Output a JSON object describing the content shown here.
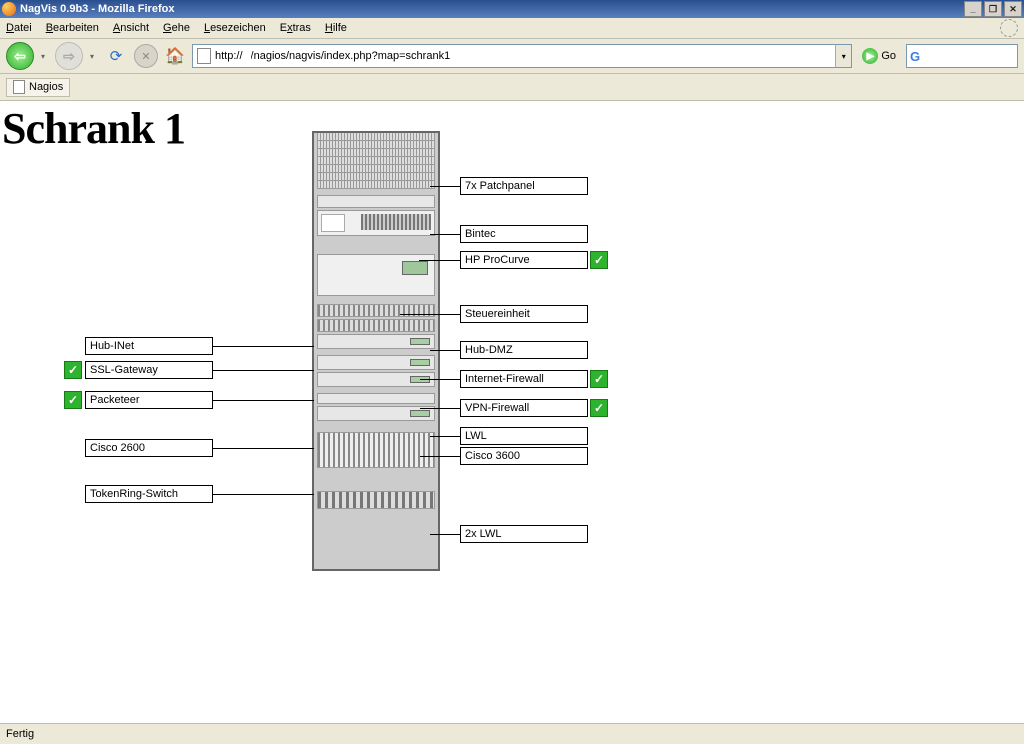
{
  "window": {
    "title": "NagVis 0.9b3 - Mozilla Firefox"
  },
  "menu": {
    "datei": "Datei",
    "bearbeiten": "Bearbeiten",
    "ansicht": "Ansicht",
    "gehe": "Gehe",
    "lesezeichen": "Lesezeichen",
    "extras": "Extras",
    "hilfe": "Hilfe"
  },
  "toolbar": {
    "url_scheme": "http://",
    "url_path": "/nagios/nagvis/index.php?map=schrank1",
    "go": "Go"
  },
  "tab": {
    "label": "Nagios"
  },
  "page": {
    "title": "Schrank 1"
  },
  "labels": {
    "patchpanel": "7x Patchpanel",
    "bintec": "Bintec",
    "hpprocurve": "HP ProCurve",
    "steuereinheit": "Steuereinheit",
    "hubdmz": "Hub-DMZ",
    "ifirewall": "Internet-Firewall",
    "vpnfirewall": "VPN-Firewall",
    "lwl": "LWL",
    "cisco3600": "Cisco 3600",
    "lwl2": "2x LWL",
    "hubinet": "Hub-INet",
    "sslgw": "SSL-Gateway",
    "packeteer": "Packeteer",
    "cisco2600": "Cisco 2600",
    "tokenring": "TokenRing-Switch"
  },
  "status": {
    "ok": "✓"
  },
  "statusbar": {
    "text": "Fertig"
  }
}
